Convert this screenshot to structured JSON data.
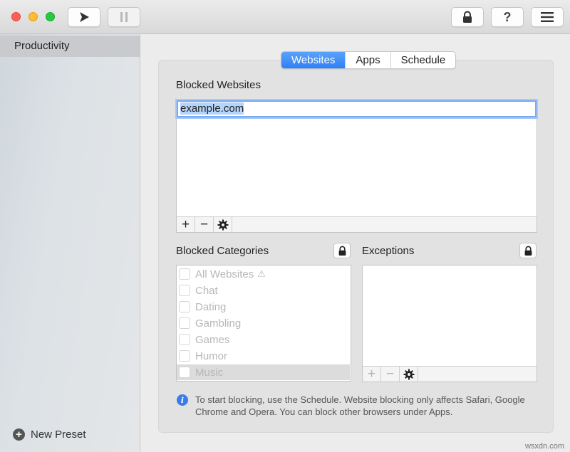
{
  "window": {
    "toolbar": {
      "play_icon": "play-icon",
      "pause_icon": "pause-icon",
      "lock_icon": "lock-icon",
      "help_label": "?",
      "menu_icon": "hamburger-menu-icon"
    }
  },
  "sidebar": {
    "items": [
      {
        "label": "Productivity",
        "selected": true
      }
    ],
    "new_preset_label": "New Preset"
  },
  "tabs": [
    {
      "label": "Websites",
      "active": true
    },
    {
      "label": "Apps",
      "active": false
    },
    {
      "label": "Schedule",
      "active": false
    }
  ],
  "blocked_websites": {
    "title": "Blocked Websites",
    "editing_value": "example.com",
    "toolbar": {
      "add": "+",
      "remove": "−",
      "settings_icon": "gear-icon"
    }
  },
  "blocked_categories": {
    "title": "Blocked Categories",
    "items": [
      {
        "label": "All Websites",
        "checked": false,
        "warning": "⚠"
      },
      {
        "label": "Chat",
        "checked": false
      },
      {
        "label": "Dating",
        "checked": false
      },
      {
        "label": "Gambling",
        "checked": false
      },
      {
        "label": "Games",
        "checked": false
      },
      {
        "label": "Humor",
        "checked": false
      },
      {
        "label": "Music",
        "checked": false,
        "selected": true
      }
    ]
  },
  "exceptions": {
    "title": "Exceptions",
    "toolbar": {
      "add": "+",
      "remove": "−",
      "settings_icon": "gear-icon"
    }
  },
  "info": {
    "text": "To start blocking, use the Schedule. Website blocking only affects Safari, Google Chrome and Opera. You can block other browsers under Apps."
  },
  "watermark": "wsxdn.com",
  "colors": {
    "accent": "#2f7ff5",
    "focus_ring": "#77aaf2",
    "close": "#fe5f57",
    "minimize": "#febc2e",
    "zoom": "#28c840",
    "info_icon": "#3a7de8"
  }
}
